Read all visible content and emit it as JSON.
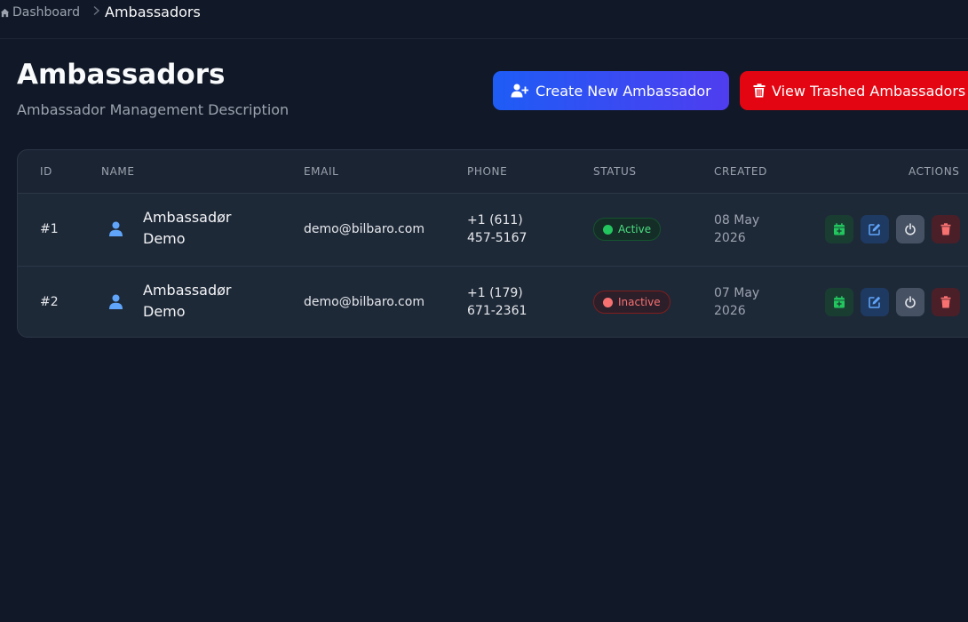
{
  "breadcrumb": {
    "home": "Dashboard",
    "separator": ">",
    "current": "Ambassadors"
  },
  "page": {
    "title": "Ambassadors",
    "description": "Ambassador Management Description"
  },
  "buttons": {
    "create": "Create New Ambassador",
    "trashed": "View Trashed Ambassadors"
  },
  "table": {
    "headers": {
      "id": "ID",
      "name": "NAME",
      "email": "EMAIL",
      "phone": "PHONE",
      "status": "STATUS",
      "created": "CREATED",
      "actions": "ACTIONS"
    },
    "rows": [
      {
        "id": "#1",
        "name_line1": "Ambassadør",
        "name_line2": "Demo",
        "email": "demo@bilbaro.com",
        "phone_line1": "+1 (611)",
        "phone_line2": "457-5167",
        "status": "Active",
        "created_line1": "08 May",
        "created_line2": "2026"
      },
      {
        "id": "#2",
        "name_line1": "Ambassadør",
        "name_line2": "Demo",
        "email": "demo@bilbaro.com",
        "phone_line1": "+1 (179)",
        "phone_line2": "671-2361",
        "status": "Inactive",
        "created_line1": "07 May",
        "created_line2": "2026"
      }
    ]
  },
  "icons": {
    "home": "home-icon",
    "user": "user-icon",
    "user_plus": "user-plus-icon",
    "trash": "trash-icon",
    "calendar_add": "calendar-plus-icon",
    "edit": "edit-icon",
    "power": "power-icon"
  },
  "colors": {
    "background": "#111827",
    "card": "#1b2433",
    "create_button": "#1e5cf5",
    "trash_button": "#e30612",
    "active": "#22c55e",
    "inactive": "#f87171",
    "link_blue": "#60a5fa"
  }
}
